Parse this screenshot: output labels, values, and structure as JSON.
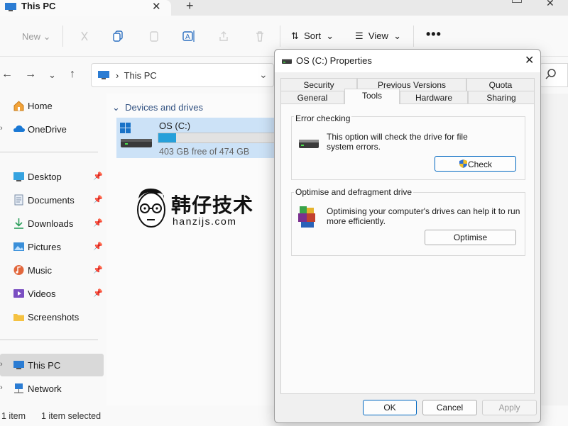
{
  "explorer": {
    "tab_title": "This PC",
    "toolbar": {
      "new_label": "New",
      "sort_label": "Sort",
      "view_label": "View",
      "more_label": "•••"
    },
    "address": {
      "crumb": "This PC"
    },
    "sidebar": {
      "items": [
        {
          "label": "Home"
        },
        {
          "label": "OneDrive"
        },
        {
          "label": "Desktop"
        },
        {
          "label": "Documents"
        },
        {
          "label": "Downloads"
        },
        {
          "label": "Pictures"
        },
        {
          "label": "Music"
        },
        {
          "label": "Videos"
        },
        {
          "label": "Screenshots"
        },
        {
          "label": "This PC"
        },
        {
          "label": "Network"
        }
      ]
    },
    "content": {
      "section_header": "Devices and drives",
      "drive": {
        "name": "OS (C:)",
        "free_text": "403 GB free of 474 GB",
        "used_fraction": 0.15
      }
    },
    "status": {
      "item_count": "1 item",
      "selection": "1 item selected"
    }
  },
  "watermark": {
    "title": "韩仔技术",
    "url": "hanzijs.com"
  },
  "dialog": {
    "title": "OS (C:) Properties",
    "tabs": {
      "security": "Security",
      "previous_versions": "Previous Versions",
      "quota": "Quota",
      "general": "General",
      "tools": "Tools",
      "hardware": "Hardware",
      "sharing": "Sharing"
    },
    "error_checking": {
      "title": "Error checking",
      "line1": "This option will check the drive for file",
      "line2": "system errors.",
      "button": "Check"
    },
    "optimise": {
      "title": "Optimise and defragment drive",
      "line1": "Optimising your computer's drives can help it to run",
      "line2": "more efficiently.",
      "button": "Optimise"
    },
    "buttons": {
      "ok": "OK",
      "cancel": "Cancel",
      "apply": "Apply"
    }
  },
  "colors": {
    "accent": "#0067c0",
    "selection": "#cce2f7",
    "drive_bar": "#26a0da"
  }
}
